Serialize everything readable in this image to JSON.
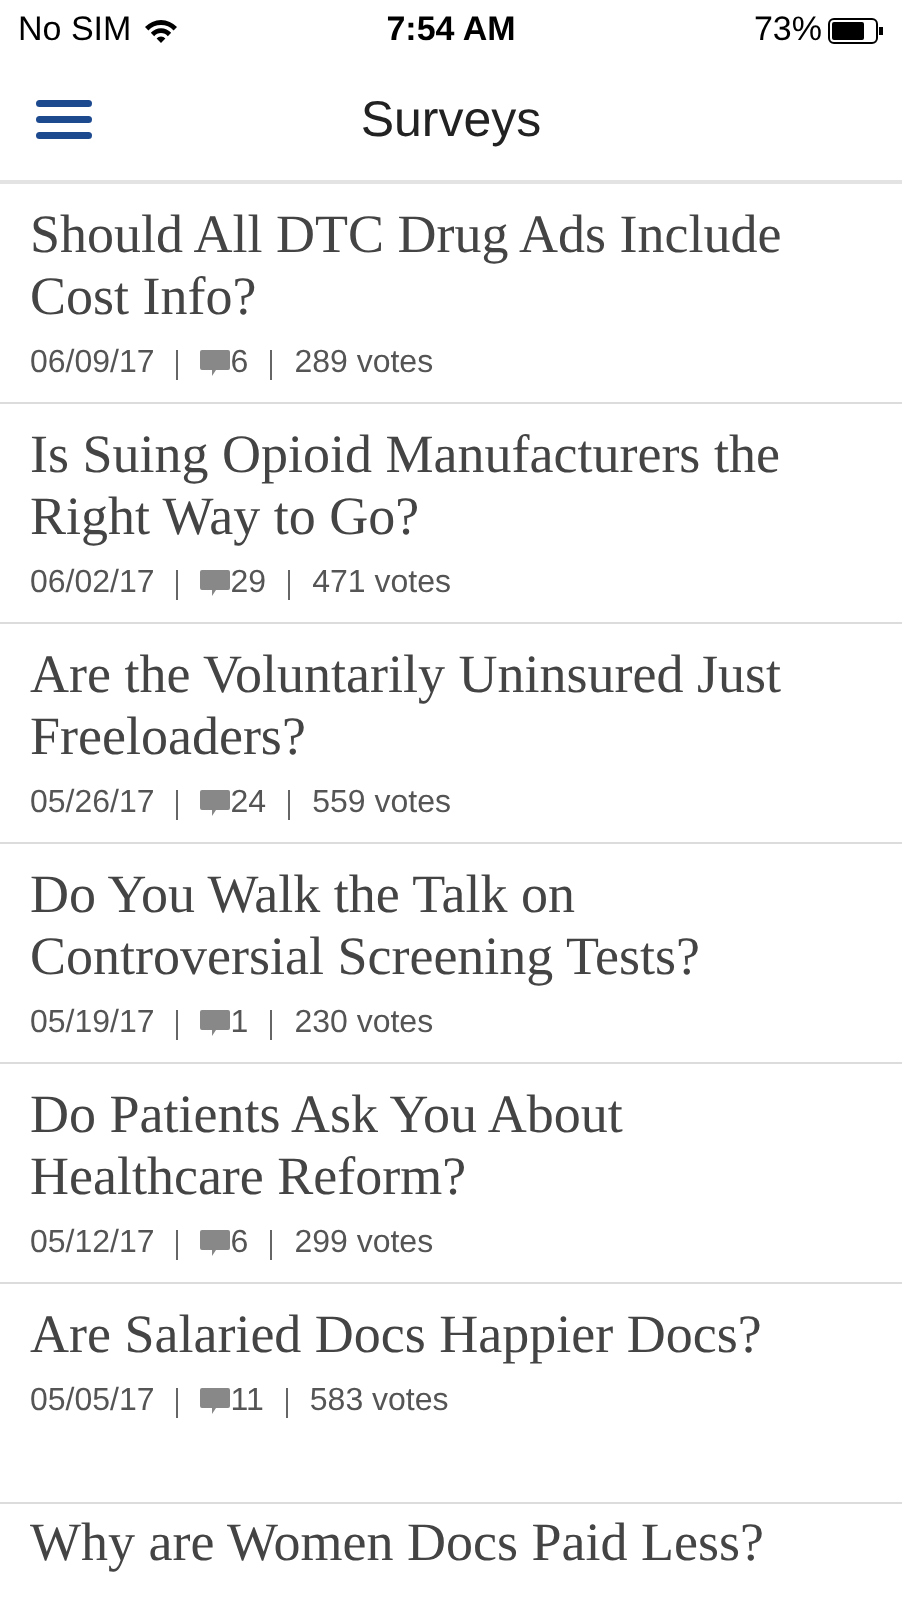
{
  "status_bar": {
    "carrier": "No SIM",
    "time": "7:54 AM",
    "battery": "73%"
  },
  "nav_bar": {
    "title": "Surveys"
  },
  "surveys": [
    {
      "title": "Should All DTC Drug Ads Include Cost Info?",
      "date": "06/09/17",
      "comments": "6",
      "votes": "289 votes"
    },
    {
      "title": "Is Suing Opioid Manufacturers the Right Way to Go?",
      "date": "06/02/17",
      "comments": "29",
      "votes": "471 votes"
    },
    {
      "title": "Are the Voluntarily Uninsured Just Freeloaders?",
      "date": "05/26/17",
      "comments": "24",
      "votes": "559 votes"
    },
    {
      "title": "Do You Walk the Talk on Controversial Screening Tests?",
      "date": "05/19/17",
      "comments": "1",
      "votes": "230 votes"
    },
    {
      "title": "Do Patients Ask You About Healthcare Reform?",
      "date": "05/12/17",
      "comments": "6",
      "votes": "299 votes"
    },
    {
      "title": "Are Salaried Docs Happier Docs?",
      "date": "05/05/17",
      "comments": "11",
      "votes": "583 votes"
    },
    {
      "title": "Why are Women Docs Paid Less?"
    }
  ]
}
